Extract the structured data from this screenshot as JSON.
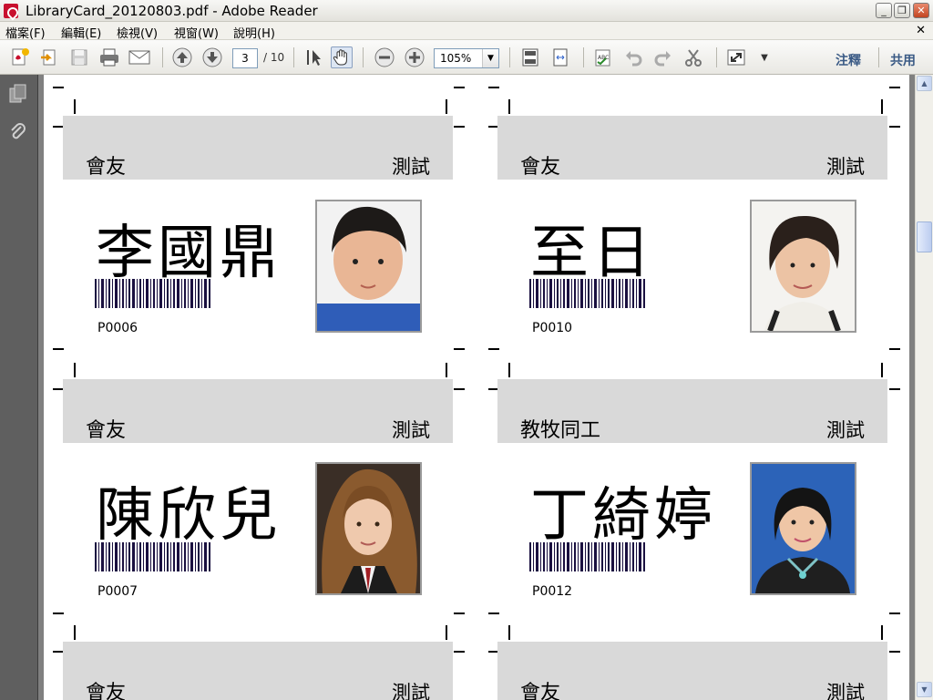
{
  "window": {
    "title": "LibraryCard_20120803.pdf - Adobe Reader",
    "min_glyph": "_",
    "restore_glyph": "❐",
    "close_glyph": "✕"
  },
  "menu": {
    "items": [
      "檔案(F)",
      "編輯(E)",
      "檢視(V)",
      "視窗(W)",
      "說明(H)"
    ],
    "close_glyph": "✕"
  },
  "toolbar": {
    "page_current": "3",
    "page_total": "/ 10",
    "zoom": "105%",
    "comment_label": "注釋",
    "share_label": "共用",
    "icons": [
      "create-pdf-icon",
      "export-icon",
      "save-icon",
      "print-icon",
      "email-icon",
      "prev-page-icon",
      "next-page-icon",
      "select-tool-icon",
      "hand-tool-icon",
      "zoom-out-icon",
      "zoom-in-icon",
      "fit-page-icon",
      "fit-width-icon",
      "sign-icon",
      "undo-icon",
      "redo-icon",
      "cut-icon",
      "fullscreen-icon",
      "more-icon"
    ]
  },
  "cards": [
    {
      "member": "會友",
      "test": "測試",
      "name": "李國鼎",
      "id": "P0006",
      "photo": "photo-boy"
    },
    {
      "member": "會友",
      "test": "測試",
      "name": "至日",
      "id": "P0010",
      "photo": "photo-woman-short-hair"
    },
    {
      "member": "會友",
      "test": "測試",
      "name": "陳欣兒",
      "id": "P0007",
      "photo": "photo-girl-curly-hair"
    },
    {
      "member": "教牧同工",
      "test": "測試",
      "name": "丁綺婷",
      "id": "P0012",
      "photo": "photo-woman-blue-background"
    },
    {
      "member": "會友",
      "test": "測試",
      "name": "",
      "id": "",
      "photo": ""
    },
    {
      "member": "會友",
      "test": "測試",
      "name": "",
      "id": "",
      "photo": ""
    }
  ]
}
